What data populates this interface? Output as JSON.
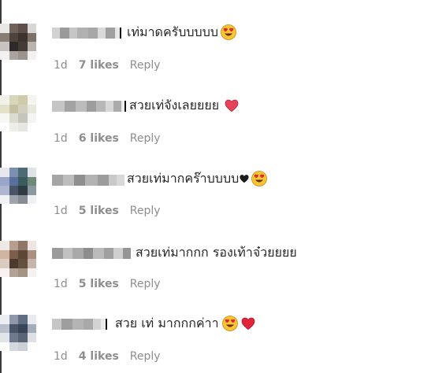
{
  "comments": [
    {
      "text": "เท่มาดครับบบบบ",
      "age": "1d",
      "likes": "7 likes",
      "reply": "Reply",
      "emojis": [
        "heart-eyes"
      ]
    },
    {
      "text": "สวยเท่จังเลยยยย",
      "age": "1d",
      "likes": "6 likes",
      "reply": "Reply",
      "emojis": [
        "red-heart"
      ]
    },
    {
      "text": "สวยเท่มากคร๊าบบบบ",
      "age": "1d",
      "likes": "5 likes",
      "reply": "Reply",
      "emojis": [
        "black-heart",
        "heart-eyes"
      ]
    },
    {
      "text": "สวยเท่มากกก รองเท้าจ๋วยยยย",
      "age": "1d",
      "likes": "5 likes",
      "reply": "Reply",
      "emojis": []
    },
    {
      "text": "สวย เท่ มากกกค่าา",
      "age": "1d",
      "likes": "4 likes",
      "reply": "Reply",
      "emojis": [
        "heart-eyes",
        "red-heart"
      ]
    }
  ]
}
